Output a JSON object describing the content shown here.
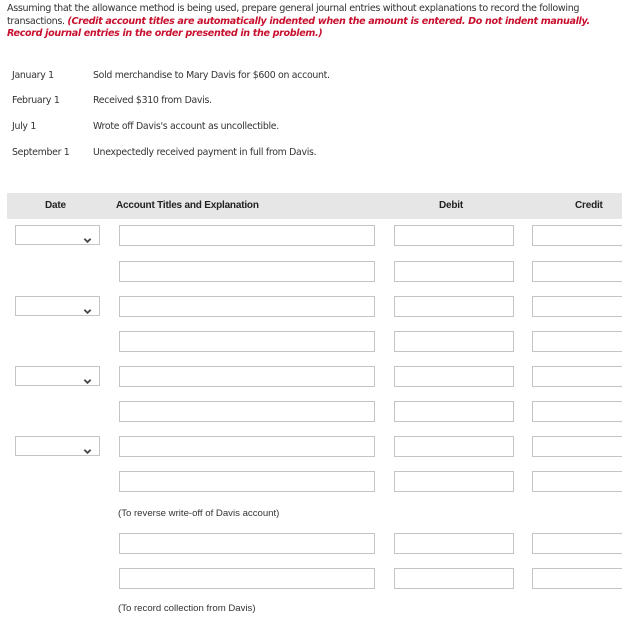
{
  "instructions": {
    "text": "Assuming that the allowance method is being used, prepare general journal entries without explanations to record the following transactions.",
    "note": "(Credit account titles are automatically indented when the amount is entered. Do not indent manually. Record journal entries in the order presented in the problem.)"
  },
  "transactions": [
    {
      "date": "January 1",
      "text": "Sold merchandise to Mary Davis for $600 on account."
    },
    {
      "date": "February 1",
      "text": "Received $310 from Davis."
    },
    {
      "date": "July 1",
      "text": "Wrote off Davis's account as uncollectible."
    },
    {
      "date": "September 1",
      "text": "Unexpectedly received payment in full from Davis."
    }
  ],
  "table": {
    "headers": {
      "date": "Date",
      "account": "Account Titles and Explanation",
      "debit": "Debit",
      "credit": "Credit"
    },
    "entries": [
      {
        "date": "",
        "rows": [
          {
            "account": "",
            "debit": "",
            "credit": ""
          },
          {
            "account": "",
            "debit": "",
            "credit": ""
          }
        ]
      },
      {
        "date": "",
        "rows": [
          {
            "account": "",
            "debit": "",
            "credit": ""
          },
          {
            "account": "",
            "debit": "",
            "credit": ""
          }
        ]
      },
      {
        "date": "",
        "rows": [
          {
            "account": "",
            "debit": "",
            "credit": ""
          },
          {
            "account": "",
            "debit": "",
            "credit": ""
          }
        ]
      },
      {
        "date": "",
        "rows": [
          {
            "account": "",
            "debit": "",
            "credit": ""
          },
          {
            "account": "",
            "debit": "",
            "credit": ""
          }
        ],
        "explanation": "(To reverse write-off of Davis account)"
      },
      {
        "date": "",
        "rows": [
          {
            "account": "",
            "debit": "",
            "credit": ""
          },
          {
            "account": "",
            "debit": "",
            "credit": ""
          }
        ],
        "explanation": "(To record collection from Davis)"
      }
    ]
  }
}
